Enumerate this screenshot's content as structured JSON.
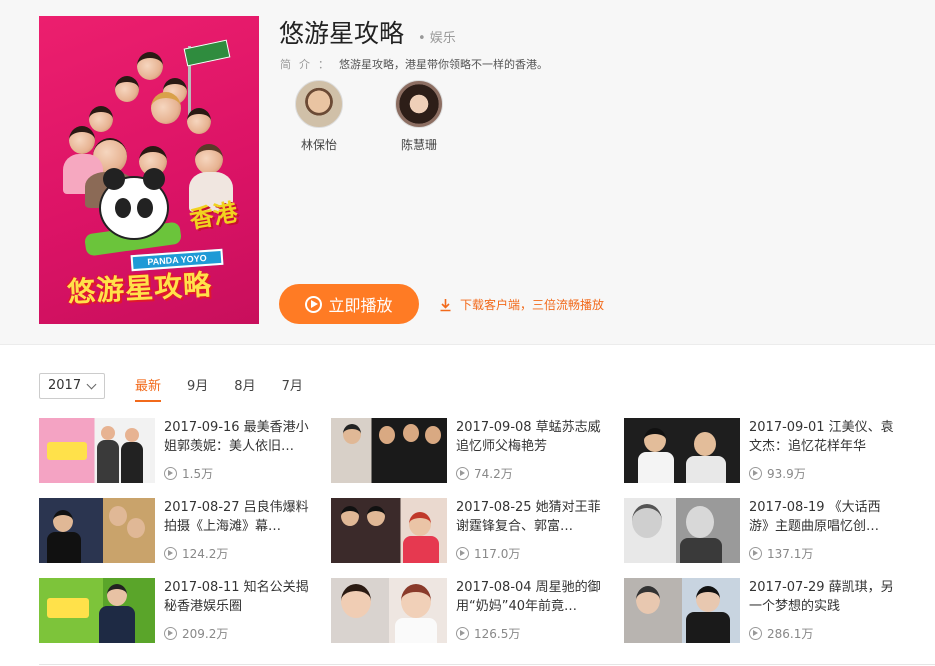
{
  "show": {
    "title": "悠游星攻略",
    "genre": "娱乐",
    "intro_label": "简介：",
    "intro_text": "悠游星攻略，港星带你领略不一样的香港。",
    "poster_banner": "PANDA YOYO",
    "poster_title": "悠游星攻略",
    "poster_hk": "香港"
  },
  "cast": [
    {
      "name": "林保怡"
    },
    {
      "name": "陈慧珊"
    }
  ],
  "actions": {
    "play_label": "立即播放",
    "download_label": "下载客户端，三倍流畅播放"
  },
  "filter": {
    "year": "2017",
    "tabs": [
      "最新",
      "9月",
      "8月",
      "7月"
    ],
    "active_tab": "最新"
  },
  "episodes": [
    {
      "title": "2017-09-16 最美香港小姐郭羡妮：美人依旧…",
      "views": "1.5万"
    },
    {
      "title": "2017-09-08 草蜢苏志威追忆师父梅艳芳",
      "views": "74.2万"
    },
    {
      "title": "2017-09-01 江美仪、袁文杰：追忆花样年华",
      "views": "93.9万"
    },
    {
      "title": "2017-08-27 吕良伟爆料拍摄《上海滩》幕…",
      "views": "124.2万"
    },
    {
      "title": "2017-08-25 她猜对王菲谢霆锋复合、郭富…",
      "views": "117.0万"
    },
    {
      "title": "2017-08-19 《大话西游》主题曲原唱忆创…",
      "views": "137.1万"
    },
    {
      "title": "2017-08-11 知名公关揭秘香港娱乐圈",
      "views": "209.2万"
    },
    {
      "title": "2017-08-04 周星驰的御用“奶妈”40年前竟…",
      "views": "126.5万"
    },
    {
      "title": "2017-07-29 薛凯琪，另一个梦想的实践",
      "views": "286.1万"
    }
  ],
  "colors": {
    "accent": "#ff7b24",
    "accent_text": "#f26a1b",
    "poster_bg": "#e0186a"
  }
}
